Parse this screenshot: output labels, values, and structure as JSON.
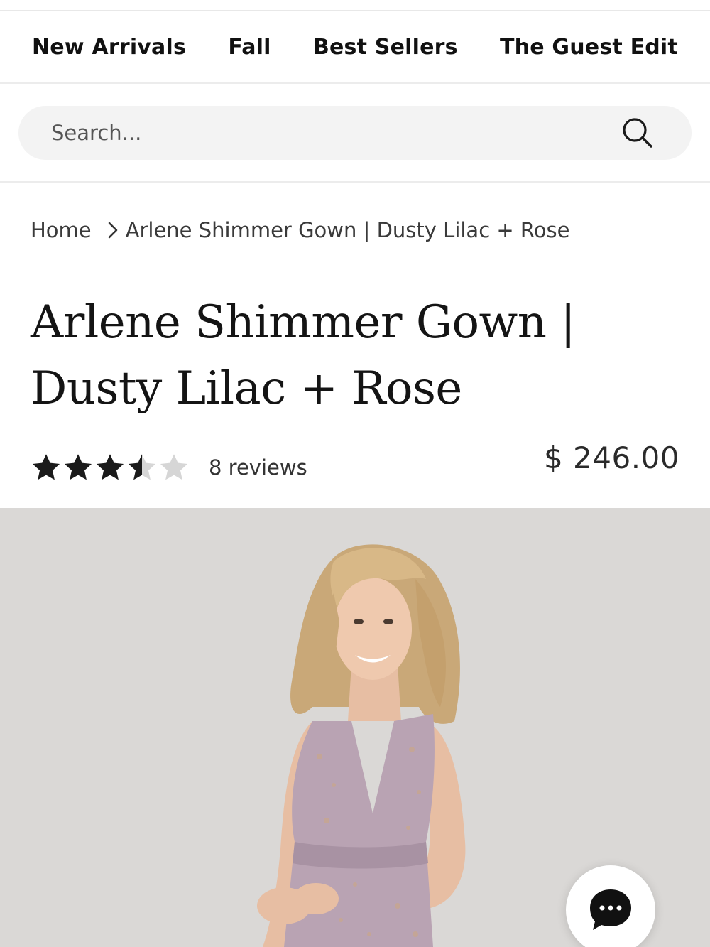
{
  "nav": {
    "items": [
      {
        "label": "New Arrivals"
      },
      {
        "label": "Fall"
      },
      {
        "label": "Best Sellers"
      },
      {
        "label": "The Guest Edit"
      }
    ]
  },
  "search": {
    "placeholder": "Search...",
    "icon": "search-icon"
  },
  "breadcrumb": {
    "home": "Home",
    "separator_icon": "chevron-right-icon",
    "current": "Arlene Shimmer Gown | Dusty Lilac + Rose"
  },
  "product": {
    "title_line1": "Arlene Shimmer Gown |",
    "title_line2": "Dusty Lilac + Rose",
    "rating": 3.5,
    "rating_max": 5,
    "reviews_label": "8 reviews",
    "price": "$ 246.00"
  },
  "image": {
    "alt": "Model wearing Arlene Shimmer Gown in Dusty Lilac + Rose",
    "background_color": "#dad8d6",
    "dress_color": "#b9a3b3"
  },
  "chat": {
    "icon": "chat-bubble-icon"
  },
  "colors": {
    "star_filled": "#1a1a1a",
    "star_empty": "#d6d6d6",
    "search_bg": "#f3f3f3"
  }
}
